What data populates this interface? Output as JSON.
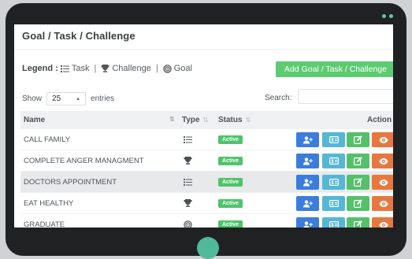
{
  "page": {
    "title": "Goal / Task / Challenge"
  },
  "legend": {
    "prefix": "Legend :",
    "task": "Task",
    "challenge": "Challenge",
    "goal": "Goal",
    "separator": "|"
  },
  "toolbar": {
    "add_label": "Add Goal / Task / Challenge"
  },
  "length": {
    "show_label": "Show",
    "value": "25",
    "entries_label": "entries"
  },
  "search": {
    "label": "Search:",
    "value": ""
  },
  "table": {
    "columns": {
      "name": "Name",
      "type": "Type",
      "status": "Status",
      "action": "Action"
    },
    "rows": [
      {
        "name": "CALL FAMILY",
        "type": "task-icon",
        "status": "Active"
      },
      {
        "name": "COMPLETE ANGER MANAGMENT",
        "type": "trophy-icon",
        "status": "Active"
      },
      {
        "name": "DOCTORS APPOINTMENT",
        "type": "task-icon",
        "status": "Active"
      },
      {
        "name": "EAT HEALTHY",
        "type": "trophy-icon",
        "status": "Active"
      },
      {
        "name": "GRADUATE",
        "type": "goal-icon",
        "status": "Active"
      }
    ]
  },
  "colors": {
    "add_button": "#5ccb71",
    "status_active": "#4fc36a",
    "assign": "#3b7ddd",
    "details": "#55b6d6",
    "edit": "#55c06a",
    "view": "#e8773e",
    "device": "#1f2122",
    "home_button": "#4fb99a"
  }
}
